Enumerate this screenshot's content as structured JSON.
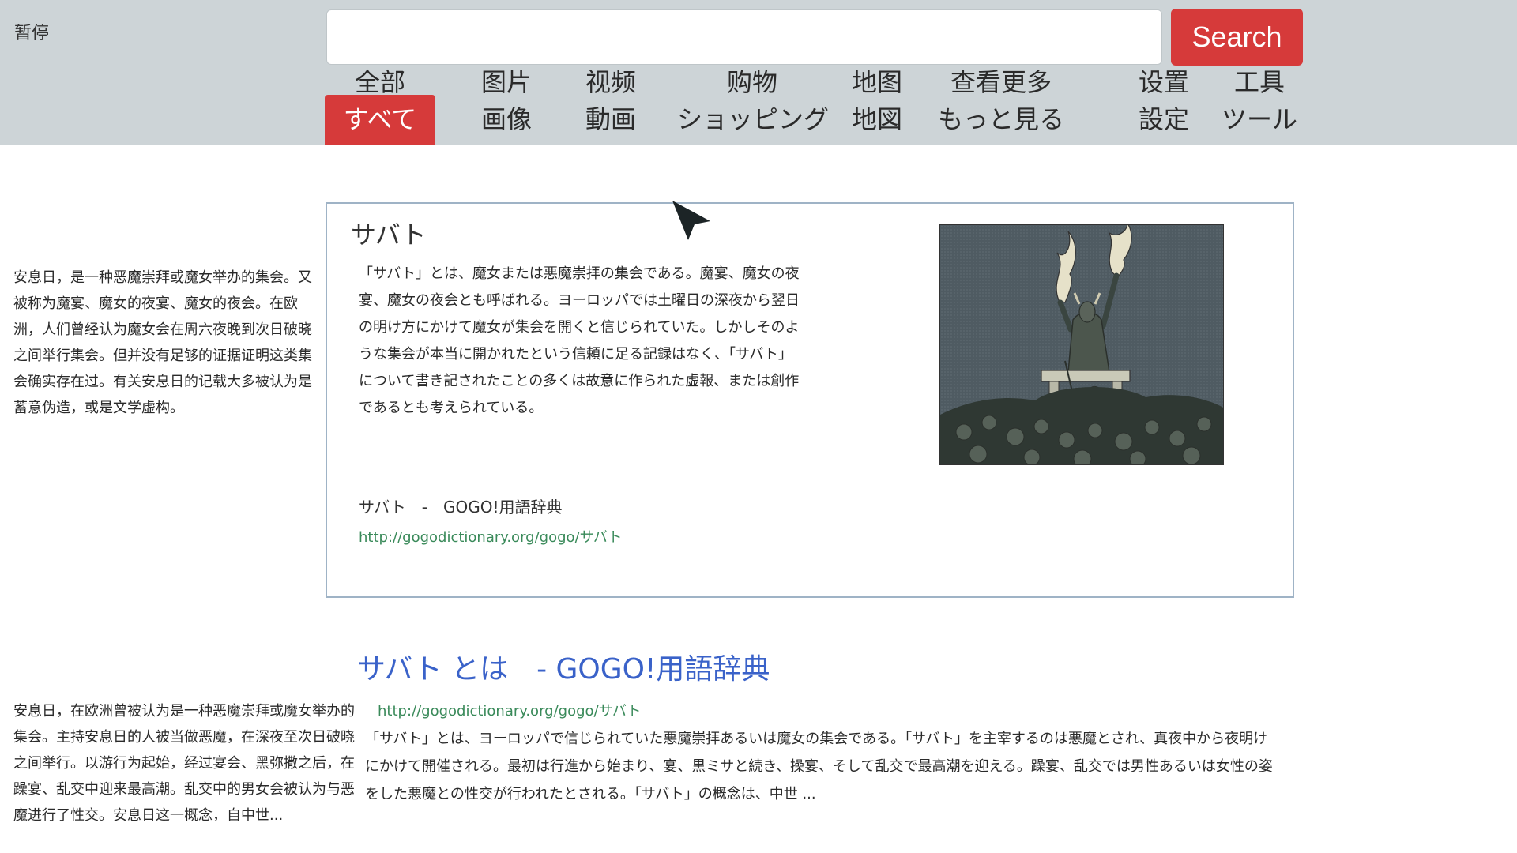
{
  "overlay": {
    "pause_label": "暂停"
  },
  "search": {
    "value": "",
    "button_label": "Search"
  },
  "tabs": [
    {
      "zh": "全部",
      "ja": "すべて",
      "active": true
    },
    {
      "zh": "图片",
      "ja": "画像"
    },
    {
      "zh": "视频",
      "ja": "動画"
    },
    {
      "zh": "购物",
      "ja": "ショッピング"
    },
    {
      "zh": "地图",
      "ja": "地図"
    },
    {
      "zh": "查看更多",
      "ja": "もっと見る"
    },
    {
      "zh": "设置",
      "ja": "設定"
    },
    {
      "zh": "工具",
      "ja": "ツール"
    }
  ],
  "subtitles": {
    "block1": "安息日，是一种恶魔崇拜或魔女举办的集会。又被称为魔宴、魔女的夜宴、魔女的夜会。在欧洲，人们曾经认为魔女会在周六夜晚到次日破晓之间举行集会。但并没有足够的证据证明这类集会确实存在过。有关安息日的记载大多被认为是蓄意伪造，或是文学虚构。",
    "block2": "安息日，在欧洲曾被认为是一种恶魔崇拜或魔女举办的集会。主持安息日的人被当做恶魔，在深夜至次日破晓之间举行。以游行为起始，经过宴会、黑弥撒之后，在躁宴、乱交中迎来最高潮。乱交中的男女会被认为与恶魔进行了性交。安息日这一概念，自中世..."
  },
  "card": {
    "title": "サバト",
    "text": "「サバト」とは、魔女または悪魔崇拝の集会である。魔宴、魔女の夜宴、魔女の夜会とも呼ばれる。ヨーロッパでは土曜日の深夜から翌日の明け方にかけて魔女が集会を開くと信じられていた。しかしそのような集会が本当に開かれたという信頼に足る記録はなく、「サバト」について書き記されたことの多くは故意に作られた虚報、または創作であるとも考えられている。",
    "source": "サバト　-　GOGO!用語辞典",
    "url": "http://gogodictionary.org/gogo/サバト"
  },
  "result": {
    "title": "サバト とは　- GOGO!用語辞典",
    "url": "http://gogodictionary.org/gogo/サバト",
    "snippet": "「サバト」とは、ヨーロッパで信じられていた悪魔崇拝あるいは魔女の集会である。「サバト」を主宰するのは悪魔とされ、真夜中から夜明けにかけて開催される。最初は行進から始まり、宴、黒ミサと続き、操宴、そして乱交で最高潮を迎える。躁宴、乱交では男性あるいは女性の姿をした悪魔との性交が行われたとされる。「サバト」の概念は、中世 ..."
  },
  "colors": {
    "topbar": "#cdd4d7",
    "accent": "#d63a3a",
    "link": "#3a62c9",
    "url": "#3a8a5a"
  }
}
